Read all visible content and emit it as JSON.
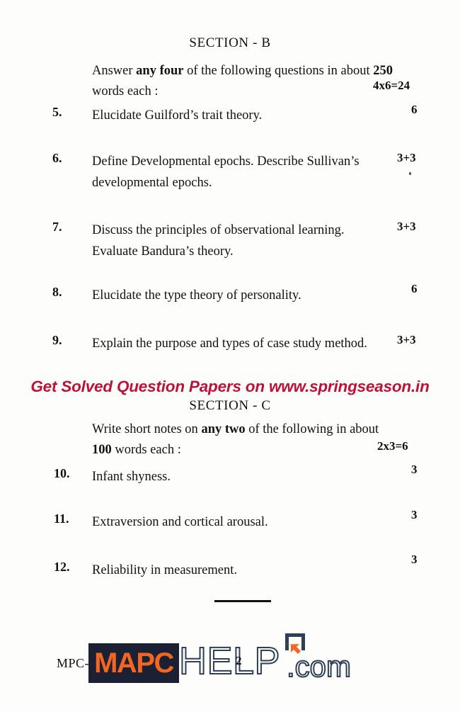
{
  "page": {
    "background_color": "#fdfdfc",
    "text_color": "#121212"
  },
  "sections": {
    "b": {
      "heading": "SECTION - B",
      "instruction_html": "Answer <b>any four</b> of the following questions in about <b>250</b> words each :",
      "total_marks": "4x6=24"
    },
    "c": {
      "heading": "SECTION - C",
      "instruction_html": "Write short notes on <b>any two</b> of the following in about <b>100</b> words each :",
      "total_marks": "2x3=6"
    }
  },
  "questions": [
    {
      "number": "5.",
      "text": "Elucidate Guilford’s trait theory.",
      "marks": "6"
    },
    {
      "number": "6.",
      "text": "Define Developmental epochs. Describe Sullivan’s developmental epochs.",
      "marks": "3+3"
    },
    {
      "number": "7.",
      "text": "Discuss the principles of observational learning. Evaluate Bandura’s theory.",
      "marks": "3+3"
    },
    {
      "number": "8.",
      "text": "Elucidate the type theory of personality.",
      "marks": "6"
    },
    {
      "number": "9.",
      "text": "Explain the purpose and types of case study method.",
      "marks": "3+3"
    },
    {
      "number": "10.",
      "text": "Infant shyness.",
      "marks": "3"
    },
    {
      "number": "11.",
      "text": "Extraversion and cortical arousal.",
      "marks": "3"
    },
    {
      "number": "12.",
      "text": "Reliability in measurement.",
      "marks": "3"
    }
  ],
  "watermark": {
    "text": "Get Solved Question Papers on www.springseason.in",
    "color": "#bd1238"
  },
  "footer": {
    "paper_code": "MPC-",
    "page_number": "2",
    "logo": {
      "mapc_text": "MAPC",
      "help_text": "HELP",
      "dotcom_text": ".com",
      "box_color": "#1b2133",
      "mapc_color": "#f26522",
      "outline_color": "#2f4056",
      "accent_color": "#f26522"
    }
  }
}
